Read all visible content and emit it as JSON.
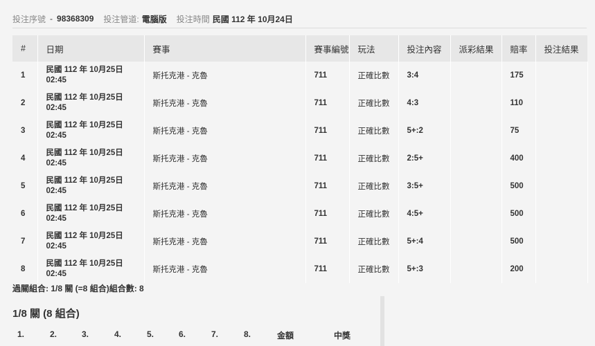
{
  "header": {
    "serial_label": "投注序號",
    "serial_sep": "-",
    "serial_value": "98368309",
    "channel_label": "投注管道:",
    "channel_value": "電腦版",
    "time_label": "投注時間",
    "time_value": "民國 112 年 10月24日"
  },
  "table": {
    "columns": [
      "#",
      "日期",
      "賽事",
      "賽事編號",
      "玩法",
      "投注內容",
      "派彩結果",
      "賠率",
      "投注結果"
    ],
    "rows": [
      {
        "no": "1",
        "date1": "民國 112 年 10月25日",
        "date2": "02:45",
        "match": "斯托克港 - 克魯",
        "event_no": "711",
        "type": "正確比數",
        "selection": "3:4",
        "payout": "",
        "odds": "175",
        "result": ""
      },
      {
        "no": "2",
        "date1": "民國 112 年 10月25日",
        "date2": "02:45",
        "match": "斯托克港 - 克魯",
        "event_no": "711",
        "type": "正確比數",
        "selection": "4:3",
        "payout": "",
        "odds": "110",
        "result": ""
      },
      {
        "no": "3",
        "date1": "民國 112 年 10月25日",
        "date2": "02:45",
        "match": "斯托克港 - 克魯",
        "event_no": "711",
        "type": "正確比數",
        "selection": "5+:2",
        "payout": "",
        "odds": "75",
        "result": ""
      },
      {
        "no": "4",
        "date1": "民國 112 年 10月25日",
        "date2": "02:45",
        "match": "斯托克港 - 克魯",
        "event_no": "711",
        "type": "正確比數",
        "selection": "2:5+",
        "payout": "",
        "odds": "400",
        "result": ""
      },
      {
        "no": "5",
        "date1": "民國 112 年 10月25日",
        "date2": "02:45",
        "match": "斯托克港 - 克魯",
        "event_no": "711",
        "type": "正確比數",
        "selection": "3:5+",
        "payout": "",
        "odds": "500",
        "result": ""
      },
      {
        "no": "6",
        "date1": "民國 112 年 10月25日",
        "date2": "02:45",
        "match": "斯托克港 - 克魯",
        "event_no": "711",
        "type": "正確比數",
        "selection": "4:5+",
        "payout": "",
        "odds": "500",
        "result": ""
      },
      {
        "no": "7",
        "date1": "民國 112 年 10月25日",
        "date2": "02:45",
        "match": "斯托克港 - 克魯",
        "event_no": "711",
        "type": "正確比數",
        "selection": "5+:4",
        "payout": "",
        "odds": "500",
        "result": ""
      },
      {
        "no": "8",
        "date1": "民國 112 年 10月25日",
        "date2": "02:45",
        "match": "斯托克港 - 克魯",
        "event_no": "711",
        "type": "正確比數",
        "selection": "5+:3",
        "payout": "",
        "odds": "200",
        "result": ""
      }
    ]
  },
  "summary": "過關組合: 1/8 關 (=8 組合)組合數: 8",
  "sub_section": {
    "title": "1/8 關 (8 組合)",
    "columns": [
      "1.",
      "2.",
      "3.",
      "4.",
      "5.",
      "6.",
      "7.",
      "8.",
      "金額",
      "中獎"
    ]
  }
}
